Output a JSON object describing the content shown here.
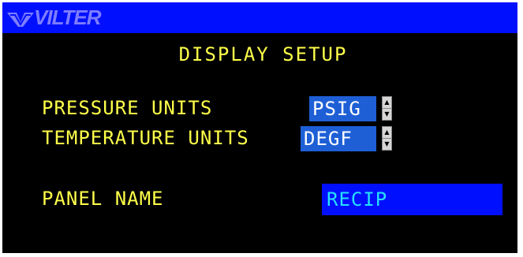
{
  "header": {
    "brand": "VILTER"
  },
  "screen": {
    "title": "DISPLAY SETUP"
  },
  "settings": {
    "pressure_units": {
      "label": "PRESSURE UNITS",
      "value": "PSIG"
    },
    "temperature_units": {
      "label": "TEMPERATURE UNITS",
      "value": "DEGF"
    },
    "panel_name": {
      "label": "PANEL NAME",
      "value": "RECIP"
    }
  },
  "colors": {
    "background": "#000000",
    "header_bar": "#0010ff",
    "label_text": "#ffff4a",
    "selected_field": "#1e5fd6",
    "panel_name_text": "#27e0ff"
  },
  "icons": {
    "logo": "vilter-logo-icon",
    "spin_up": "arrow-up-icon",
    "spin_down": "arrow-down-icon"
  }
}
